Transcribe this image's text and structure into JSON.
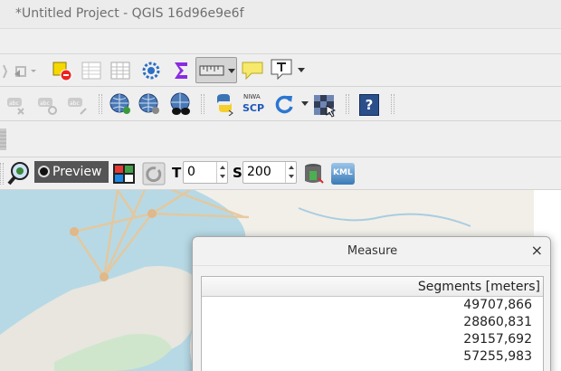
{
  "window": {
    "title": "*Untitled Project - QGIS 16d96e9e6f"
  },
  "toolbar4": {
    "preview_label": "Preview",
    "t_label": "T",
    "t_value": "0",
    "s_label": "S",
    "s_value": "200"
  },
  "icons": {
    "niwa_top": "NIWA",
    "niwa_bottom": "SCP",
    "kml": "KML",
    "help": "?"
  },
  "measure": {
    "title": "Measure",
    "close": "×",
    "column_header": "Segments [meters]",
    "segments": [
      "49707,866",
      "28860,831",
      "29157,692",
      "57255,983"
    ]
  }
}
